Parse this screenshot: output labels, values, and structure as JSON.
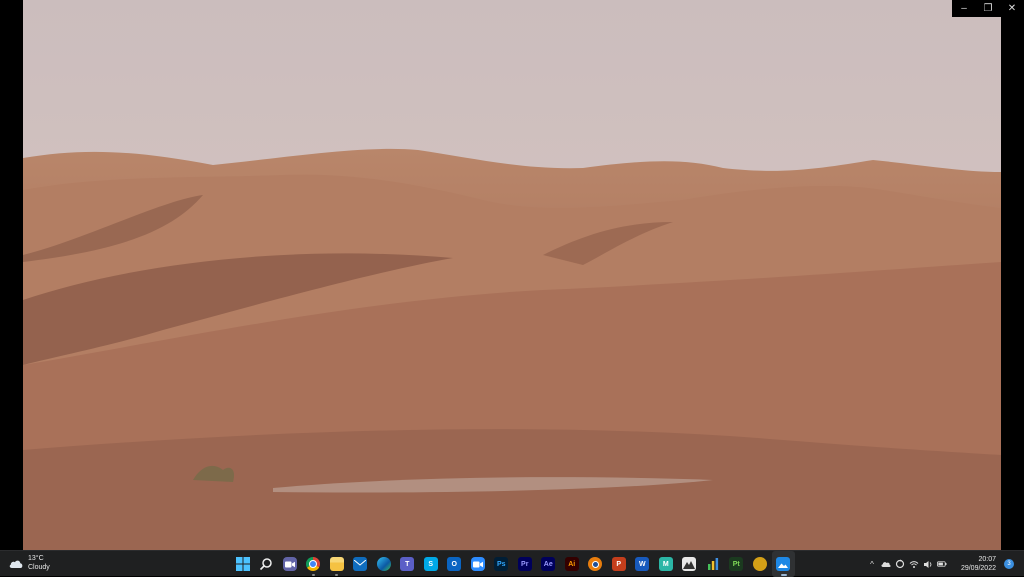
{
  "window": {
    "minimize_glyph": "–",
    "restore_glyph": "❐",
    "close_glyph": "✕"
  },
  "weather": {
    "temperature": "13°C",
    "condition": "Cloudy",
    "icon": "cloud-icon"
  },
  "taskbar_apps": [
    {
      "name": "start",
      "icon": "windows-start-icon",
      "label": "",
      "color": "#1e90ff"
    },
    {
      "name": "search",
      "icon": "search-icon",
      "label": "",
      "color": "#1f2021"
    },
    {
      "name": "chat",
      "icon": "teams-chat-icon",
      "label": "",
      "color": "#6264a7"
    },
    {
      "name": "chrome",
      "icon": "chrome-icon",
      "label": "",
      "color": "#db4437"
    },
    {
      "name": "file-explorer",
      "icon": "folder-icon",
      "label": "",
      "color": "#f5c242"
    },
    {
      "name": "mail",
      "icon": "mail-icon",
      "label": "",
      "color": "#0f6cbd"
    },
    {
      "name": "edge",
      "icon": "edge-icon",
      "label": "",
      "color": "#0c8ee0"
    },
    {
      "name": "teams",
      "icon": "teams-icon",
      "label": "",
      "color": "#5b5fc7"
    },
    {
      "name": "skype",
      "icon": "skype-icon",
      "label": "S",
      "color": "#00a8e6"
    },
    {
      "name": "outlook",
      "icon": "outlook-icon",
      "label": "O",
      "color": "#0a64c2"
    },
    {
      "name": "zoom",
      "icon": "zoom-icon",
      "label": "",
      "color": "#2d8cff"
    },
    {
      "name": "photoshop",
      "icon": "photoshop-icon",
      "label": "Ps",
      "color": "#001e36"
    },
    {
      "name": "premiere-pro",
      "icon": "premiere-pro-icon",
      "label": "Pr",
      "color": "#00005b"
    },
    {
      "name": "after-effects",
      "icon": "after-effects-icon",
      "label": "Ae",
      "color": "#00005b"
    },
    {
      "name": "illustrator",
      "icon": "illustrator-icon",
      "label": "Ai",
      "color": "#330000"
    },
    {
      "name": "blender",
      "icon": "blender-icon",
      "label": "",
      "color": "#e87d0d"
    },
    {
      "name": "powerpoint",
      "icon": "powerpoint-icon",
      "label": "P",
      "color": "#c43e1c"
    },
    {
      "name": "word",
      "icon": "word-icon",
      "label": "W",
      "color": "#185abd"
    },
    {
      "name": "app-m",
      "icon": "m-app-icon",
      "label": "M",
      "color": "#2bb6a6"
    },
    {
      "name": "app-mountain",
      "icon": "mountain-app-icon",
      "label": "",
      "color": "#e8e8e8"
    },
    {
      "name": "app-chart",
      "icon": "chart-app-icon",
      "label": "",
      "color": "#2d7d46"
    },
    {
      "name": "app-pt",
      "icon": "pt-app-icon",
      "label": "Pt",
      "color": "#1b3a1f"
    },
    {
      "name": "app-circle",
      "icon": "circle-app-icon",
      "label": "",
      "color": "#d4a017"
    },
    {
      "name": "photos",
      "icon": "photos-icon",
      "label": "",
      "color": "#1e88e5"
    }
  ],
  "tray": {
    "chevron": "^",
    "icons": [
      "onedrive-icon",
      "sync-icon",
      "wifi-icon",
      "volume-icon",
      "battery-icon"
    ],
    "time": "20:07",
    "date": "29/09/2022",
    "notification_count": "3"
  }
}
